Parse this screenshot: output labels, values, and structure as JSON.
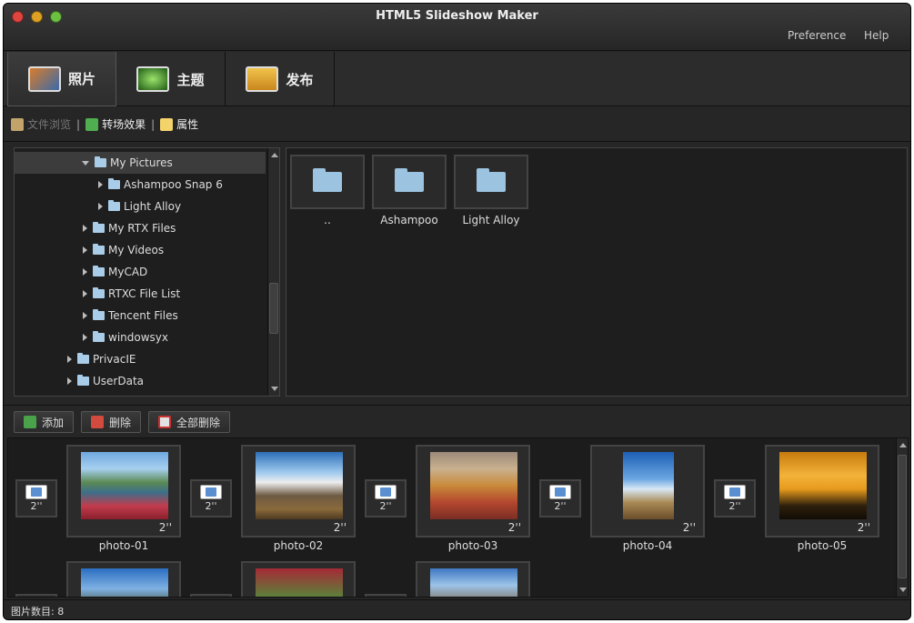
{
  "window": {
    "title": "HTML5 Slideshow Maker",
    "traffic_lights": {
      "close": "#e0443e",
      "minimize": "#dea123",
      "zoom": "#6cbf40"
    }
  },
  "top_menu": {
    "preference": "Preference",
    "help": "Help"
  },
  "tabs": [
    {
      "label": "照片",
      "icon": "photos-icon",
      "active": true
    },
    {
      "label": "主题",
      "icon": "theme-icon",
      "active": false
    },
    {
      "label": "发布",
      "icon": "publish-icon",
      "active": false
    }
  ],
  "subtabs": [
    {
      "label": "文件浏览",
      "icon": "file-browse-icon",
      "disabled": true
    },
    {
      "label": "转场效果",
      "icon": "transition-icon",
      "disabled": false
    },
    {
      "label": "属性",
      "icon": "properties-icon",
      "disabled": false
    }
  ],
  "subtab_separator": "|",
  "tree": {
    "items": [
      {
        "label": "My Pictures",
        "expanded": true,
        "selected": true
      },
      {
        "label": "Ashampoo Snap 6",
        "expanded": false,
        "selected": false
      },
      {
        "label": "Light Alloy",
        "expanded": false,
        "selected": false
      },
      {
        "label": "My RTX Files",
        "expanded": false,
        "selected": false
      },
      {
        "label": "My Videos",
        "expanded": false,
        "selected": false
      },
      {
        "label": "MyCAD",
        "expanded": false,
        "selected": false
      },
      {
        "label": "RTXC File List",
        "expanded": false,
        "selected": false
      },
      {
        "label": "Tencent Files",
        "expanded": false,
        "selected": false
      },
      {
        "label": "windowsyx",
        "expanded": false,
        "selected": false
      },
      {
        "label": "PrivacIE",
        "expanded": false,
        "selected": false
      },
      {
        "label": "UserData",
        "expanded": false,
        "selected": false
      }
    ]
  },
  "files": [
    {
      "label": ".."
    },
    {
      "label": "Ashampoo"
    },
    {
      "label": "Light Alloy"
    }
  ],
  "actions": {
    "add": "添加",
    "delete": "删除",
    "delete_all": "全部删除"
  },
  "slides": [
    {
      "caption": "photo-01",
      "duration": "2''",
      "transition": "2''"
    },
    {
      "caption": "photo-02",
      "duration": "2''",
      "transition": "2''"
    },
    {
      "caption": "photo-03",
      "duration": "2''",
      "transition": "2''"
    },
    {
      "caption": "photo-04",
      "duration": "2''",
      "transition": "2''"
    },
    {
      "caption": "photo-05",
      "duration": "2''",
      "transition": "2''"
    }
  ],
  "status": {
    "text": "图片数目: 8"
  }
}
